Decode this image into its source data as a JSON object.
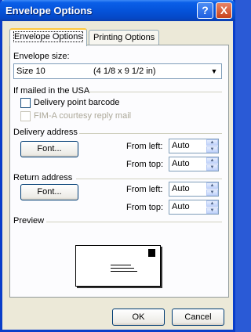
{
  "window": {
    "title": "Envelope Options",
    "help_button": "?",
    "close_button": "X"
  },
  "tabs": [
    {
      "label": "Envelope Options",
      "active": true
    },
    {
      "label": "Printing Options",
      "active": false
    }
  ],
  "envelope_size": {
    "label": "Envelope size:",
    "selected_name": "Size 10",
    "selected_dimensions": "(4 1/8 x 9 1/2 in)"
  },
  "usa_group": {
    "label": "If mailed in the USA",
    "delivery_barcode": {
      "label": "Delivery point barcode",
      "checked": false,
      "enabled": true
    },
    "fim_a": {
      "label": "FIM-A courtesy reply mail",
      "checked": false,
      "enabled": false
    }
  },
  "delivery_address": {
    "label": "Delivery address",
    "font_button": "Font...",
    "from_left_label": "From left:",
    "from_left_value": "Auto",
    "from_top_label": "From top:",
    "from_top_value": "Auto"
  },
  "return_address": {
    "label": "Return address",
    "font_button": "Font...",
    "from_left_label": "From left:",
    "from_left_value": "Auto",
    "from_top_label": "From top:",
    "from_top_value": "Auto"
  },
  "preview": {
    "label": "Preview"
  },
  "footer": {
    "ok": "OK",
    "cancel": "Cancel"
  },
  "colors": {
    "titlebar": "#0553da",
    "dialog_bg": "#ece9d8",
    "panel_bg": "#fcfcfe",
    "active_tab_accent": "#ffc83c"
  }
}
